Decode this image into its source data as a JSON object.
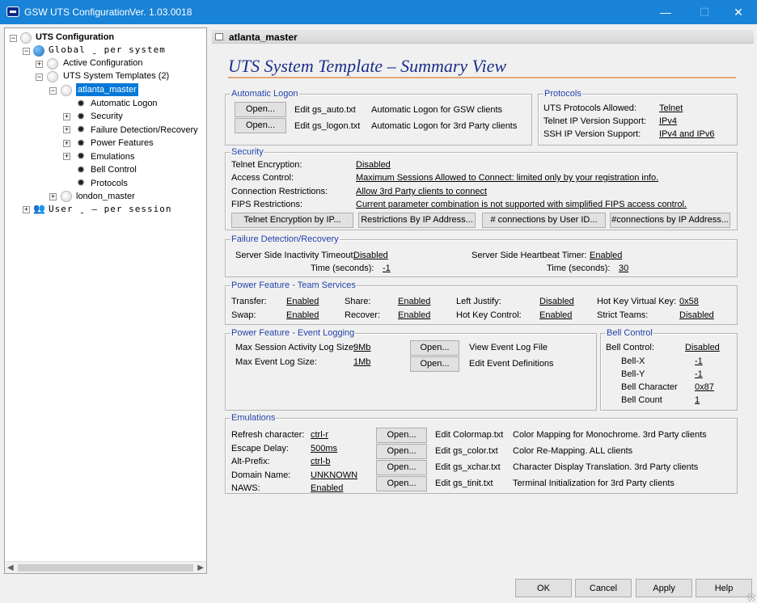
{
  "window": {
    "title": "GSW UTS Configuration",
    "version": "Ver. 1.03.0018",
    "controls": {
      "minimize": "—",
      "maximize": "☐",
      "close": "✕"
    }
  },
  "tree": {
    "root": "UTS Configuration",
    "global": "Global  ˍ  per system",
    "active_config": "Active Configuration",
    "templates": "UTS System Templates (2)",
    "selected_template": "atlanta_master",
    "sections": [
      "Automatic Logon",
      "Security",
      "Failure Detection/Recovery",
      "Power Features",
      "Emulations",
      "Bell Control",
      "Protocols"
    ],
    "other_template": "london_master",
    "user": "User  ˍ  – per session",
    "expanders": {
      "minus": "−",
      "plus": "+"
    },
    "scroll": {
      "left": "◀",
      "right": "▶"
    }
  },
  "tab": {
    "title": "atlanta_master"
  },
  "page_title": "UTS System Template – Summary View",
  "automatic_logon": {
    "legend": "Automatic Logon",
    "rows": [
      {
        "button": "Open...",
        "edit": "Edit gs_auto.txt",
        "desc": "Automatic Logon for GSW clients"
      },
      {
        "button": "Open...",
        "edit": "Edit gs_logon.txt",
        "desc": "Automatic Logon for 3rd Party clients"
      }
    ]
  },
  "protocols": {
    "legend": "Protocols",
    "rows": [
      {
        "label": "UTS Protocols Allowed:",
        "value": "Telnet"
      },
      {
        "label": "Telnet IP Version Support:",
        "value": "IPv4"
      },
      {
        "label": "SSH IP Version Support:",
        "value": "IPv4 and IPv6"
      }
    ]
  },
  "security": {
    "legend": "Security",
    "rows": [
      {
        "label": "Telnet Encryption:",
        "value": "Disabled"
      },
      {
        "label": "Access Control:",
        "value": "Maximum Sessions Allowed to Connect: limited only by your registration info."
      },
      {
        "label": "Connection Restrictions:",
        "value": "Allow 3rd Party clients to connect"
      },
      {
        "label": "FIPS Restrictions:",
        "value": "Current parameter combination is not supported with simplified FIPS access control."
      }
    ],
    "buttons": [
      "Telnet Encryption by IP...",
      "Restrictions By IP Address...",
      "# connections by User ID...",
      "#connections by IP Address..."
    ]
  },
  "failure": {
    "legend": "Failure Detection/Recovery",
    "inactivity_label": "Server Side Inactivity Timeout:",
    "inactivity_value": "Disabled",
    "inactivity_time_label": "Time (seconds):",
    "inactivity_time_value": "-1",
    "heartbeat_label": "Server Side Heartbeat Timer:",
    "heartbeat_value": "Enabled",
    "heartbeat_time_label": "Time (seconds):",
    "heartbeat_time_value": "30"
  },
  "team": {
    "legend": "Power Feature - Team Services",
    "items": [
      {
        "label": "Transfer:",
        "value": "Enabled"
      },
      {
        "label": "Share:",
        "value": "Enabled"
      },
      {
        "label": "Left Justify:",
        "value": "Disabled"
      },
      {
        "label": "Hot Key Virtual Key:",
        "value": "0x58"
      },
      {
        "label": "Swap:",
        "value": "Enabled"
      },
      {
        "label": "Recover:",
        "value": "Enabled"
      },
      {
        "label": "Hot Key Control:",
        "value": "Enabled"
      },
      {
        "label": "Strict Teams:",
        "value": "Disabled"
      }
    ]
  },
  "event_logging": {
    "legend": "Power Feature - Event Logging",
    "rows": [
      {
        "label": "Max Session Activity Log Size:",
        "value": "9Mb",
        "button": "Open...",
        "desc": "View Event Log File"
      },
      {
        "label": "Max Event Log Size:",
        "value": "1Mb",
        "button": "Open...",
        "desc": "Edit Event Definitions"
      }
    ]
  },
  "bell": {
    "legend": "Bell Control",
    "rows": [
      {
        "label": "Bell Control:",
        "value": "Disabled"
      },
      {
        "label": "Bell-X",
        "value": "-1"
      },
      {
        "label": "Bell-Y",
        "value": "-1"
      },
      {
        "label": "Bell Character",
        "value": "0x87"
      },
      {
        "label": "Bell Count",
        "value": "1"
      }
    ]
  },
  "emulations": {
    "legend": "Emulations",
    "rows": [
      {
        "label": "Refresh character:",
        "value": "ctrl-r",
        "button": "Open...",
        "edit": "Edit Colormap.txt",
        "desc": "Color Mapping for Monochrome. 3rd Party clients"
      },
      {
        "label": "Escape Delay:",
        "value": "500ms",
        "button": "Open...",
        "edit": "Edit gs_color.txt",
        "desc": "Color Re-Mapping. ALL clients"
      },
      {
        "label": "Alt-Prefix:",
        "value": "ctrl-b",
        "button": "Open...",
        "edit": "Edit gs_xchar.txt",
        "desc": "Character Display Translation. 3rd Party clients"
      },
      {
        "label": "Domain Name:",
        "value": "UNKNOWN",
        "button": "Open...",
        "edit": "Edit gs_tinit.txt",
        "desc": "Terminal Initialization for 3rd Party clients"
      },
      {
        "label": "NAWS:",
        "value": "Enabled"
      }
    ]
  },
  "footer": {
    "ok": "OK",
    "cancel": "Cancel",
    "apply": "Apply",
    "help": "Help"
  }
}
